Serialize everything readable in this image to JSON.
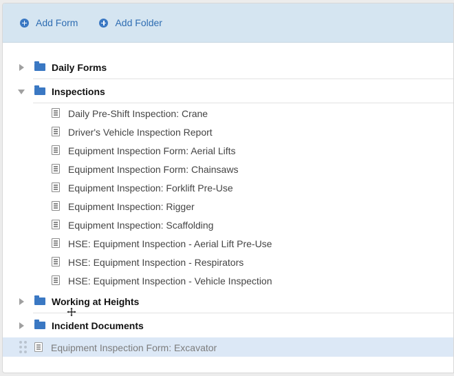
{
  "toolbar": {
    "add_form_label": "Add Form",
    "add_folder_label": "Add Folder"
  },
  "folders": [
    {
      "label": "Daily Forms",
      "expanded": false
    },
    {
      "label": "Inspections",
      "expanded": true
    },
    {
      "label": "Working at Heights",
      "expanded": false
    },
    {
      "label": "Incident Documents",
      "expanded": false
    }
  ],
  "inspection_forms": [
    "Daily Pre-Shift Inspection: Crane",
    "Driver's Vehicle Inspection Report",
    "Equipment Inspection Form: Aerial Lifts",
    "Equipment Inspection Form: Chainsaws",
    "Equipment Inspection: Forklift Pre-Use",
    "Equipment Inspection: Rigger",
    "Equipment Inspection: Scaffolding",
    "HSE: Equipment Inspection - Aerial Lift Pre-Use",
    "HSE: Equipment Inspection - Respirators",
    "HSE: Equipment Inspection - Vehicle Inspection"
  ],
  "dragging_item": {
    "label": "Equipment Inspection Form: Excavator"
  },
  "colors": {
    "accent": "#3a78c3",
    "toolbar_bg": "#d5e5f1",
    "drag_highlight": "#dce8f6"
  }
}
